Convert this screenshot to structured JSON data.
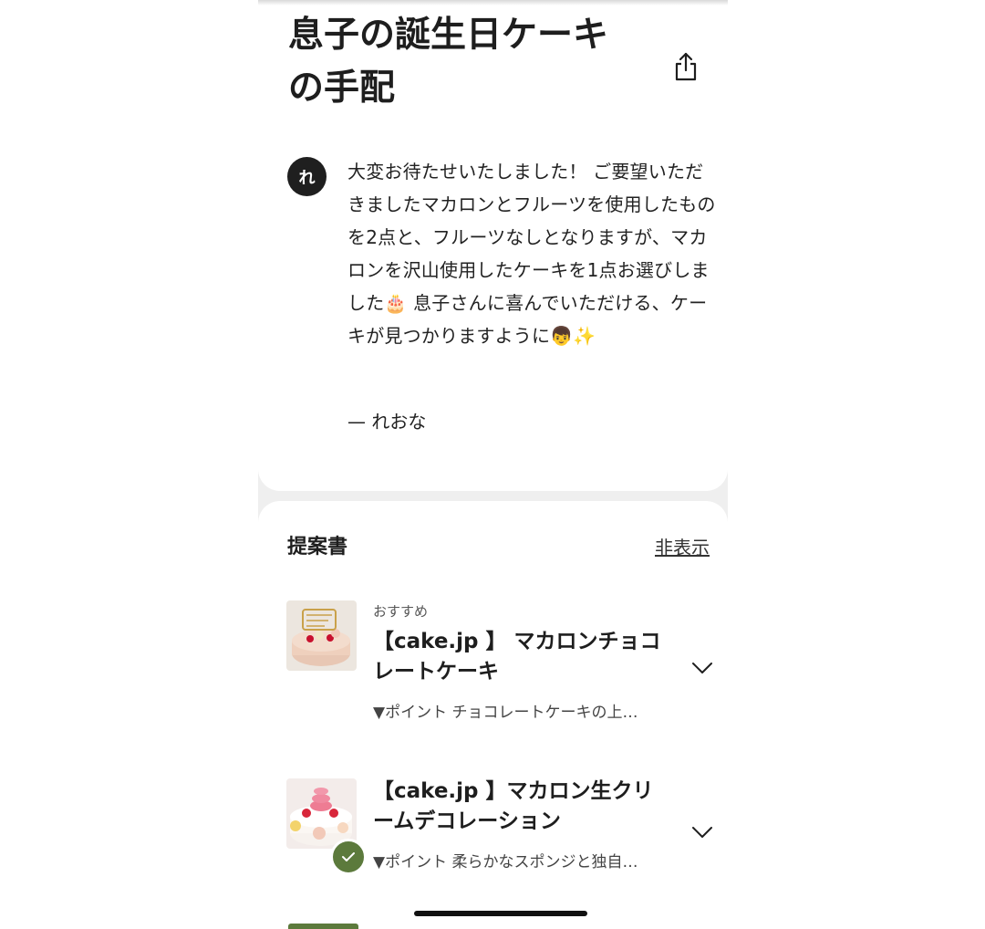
{
  "header": {
    "title_line1": "息子の誕生日ケーキ",
    "title_line2": "の手配",
    "share_icon": "share-icon"
  },
  "message": {
    "avatar_initial": "れ",
    "body_before_cake": "大変お待たせいたしました！ ご要望いただきましたマカロンとフルーツを使用したものを2点と、フルーツなしとなりますが、マカロンを沢山使用したケーキを1点お選びしました",
    "cake_emoji": "🎂",
    "body_middle": " 息子さんに喜んでいただける、ケーキが見つかりますように",
    "boy_emoji": "👦",
    "sparkle_emoji": "✨",
    "signature": "— れおな"
  },
  "proposals": {
    "section_title": "提案書",
    "hide_label": "非表示",
    "items": [
      {
        "tag": "おすすめ",
        "title": "【cake.jp 】 マカロンチョコレートケーキ",
        "description": "▼ポイント チョコレートケーキの上…",
        "selected": false
      },
      {
        "tag": "",
        "title": "【cake.jp 】マカロン生クリームデコレーション",
        "description": "▼ポイント 柔らかなスポンジと独自…",
        "selected": true
      }
    ]
  },
  "colors": {
    "accent_green": "#5c7a3c",
    "background_gray": "#efefef",
    "text_dark": "#1e1e1e"
  }
}
